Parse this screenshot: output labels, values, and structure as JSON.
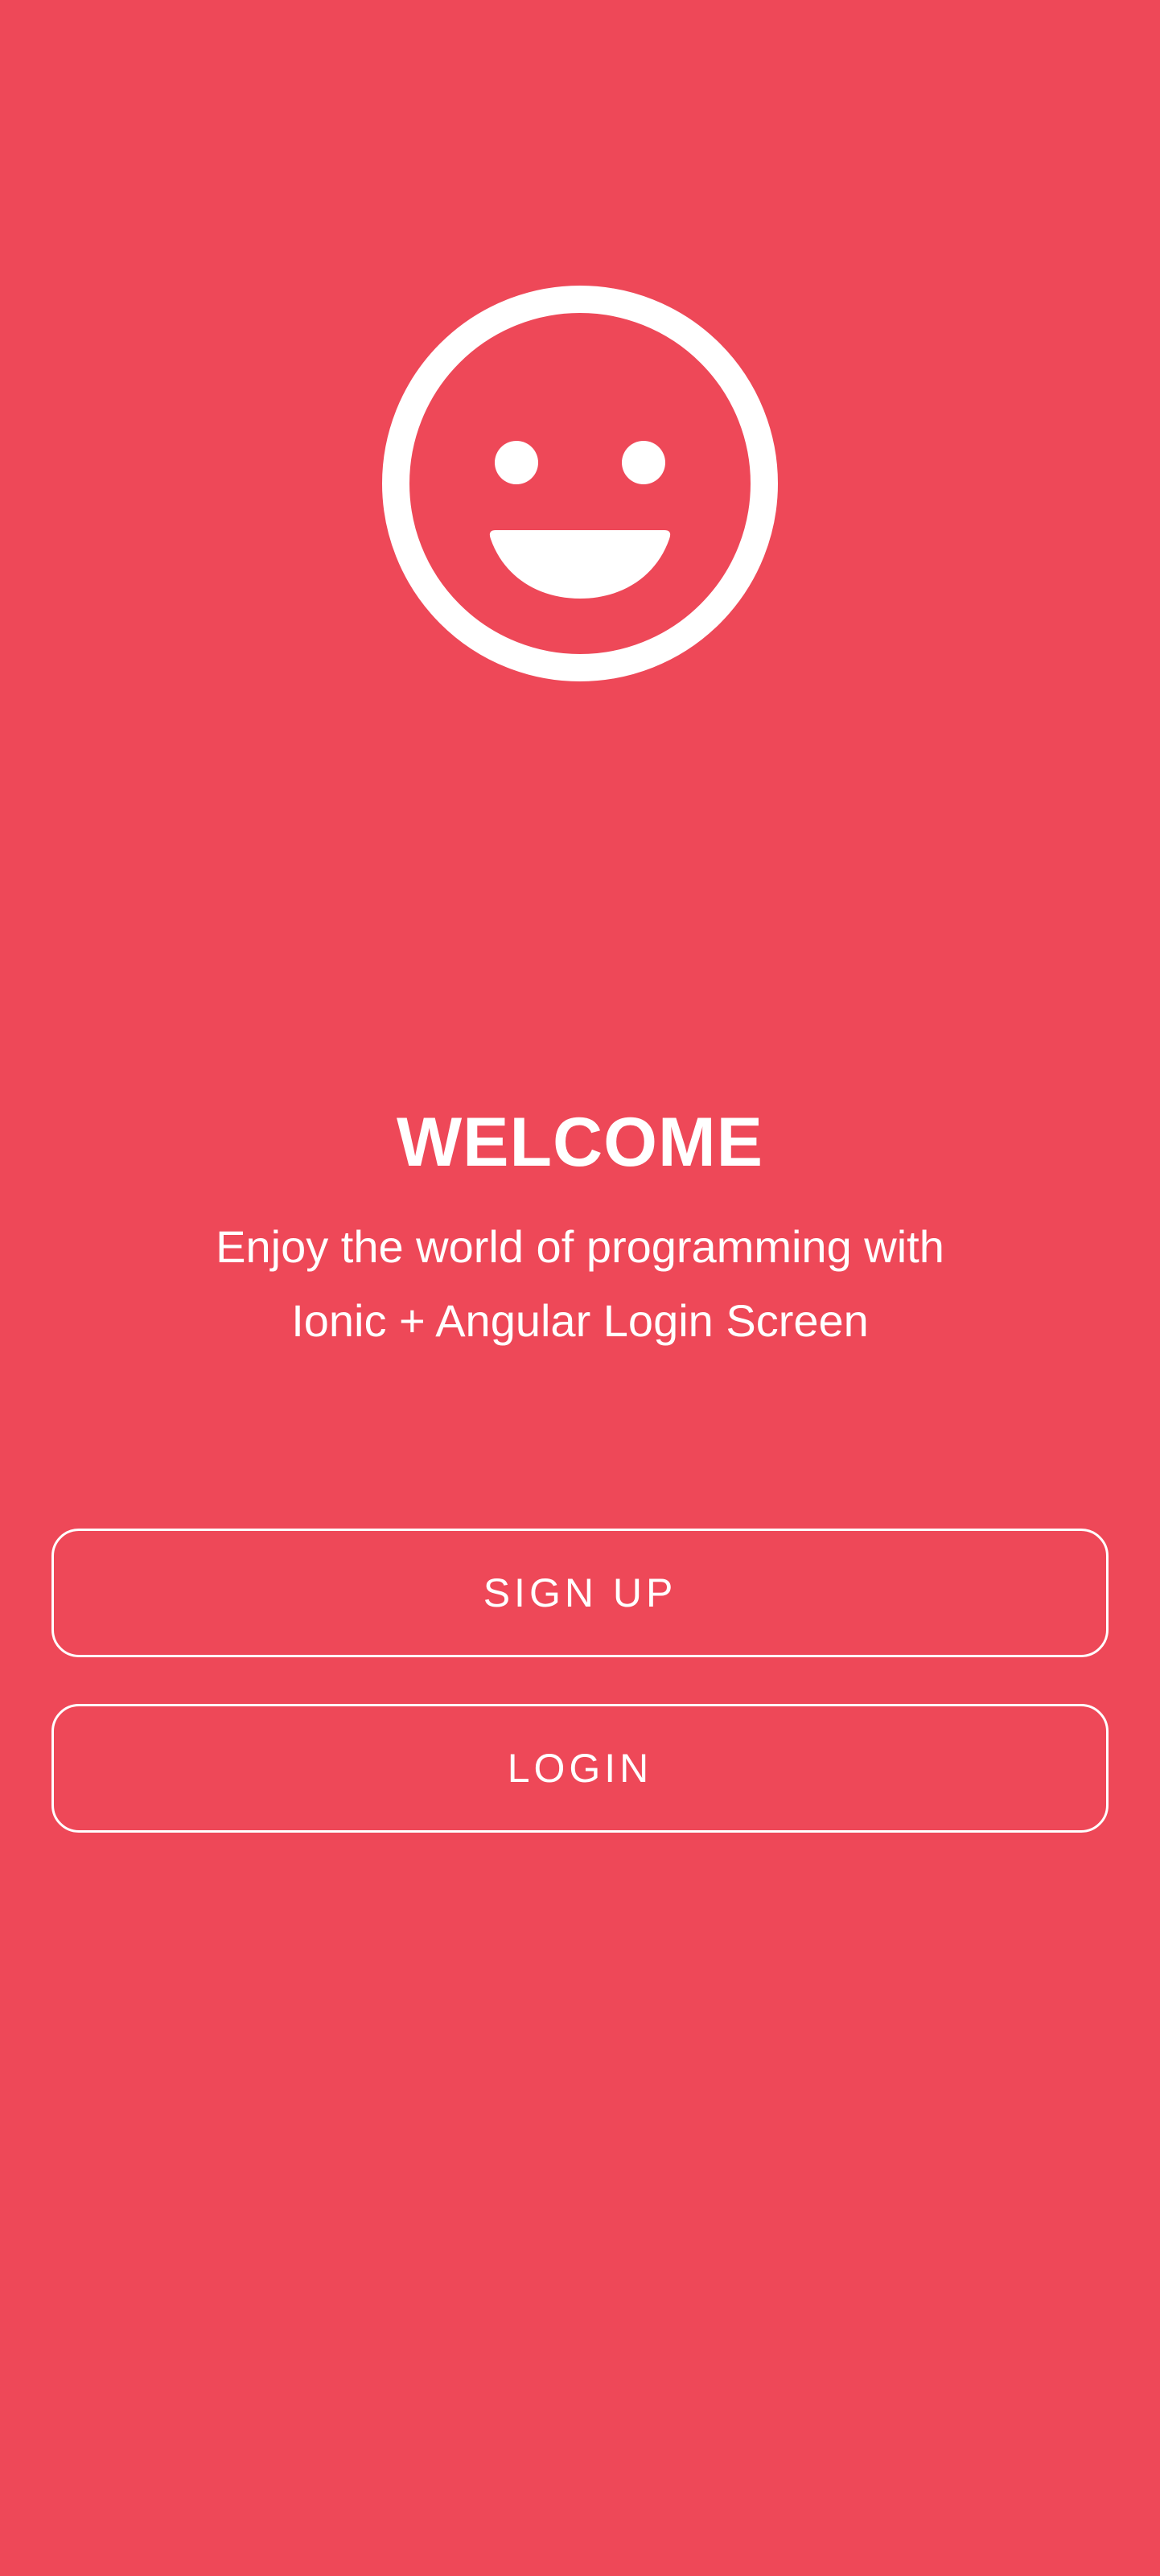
{
  "theme": {
    "background": "#ee4858",
    "foreground": "#ffffff"
  },
  "hero": {
    "icon": "happy-outline-icon"
  },
  "welcome": {
    "title": "WELCOME",
    "subtitle_line1": "Enjoy the world of programming with",
    "subtitle_line2": "Ionic + Angular Login Screen"
  },
  "actions": {
    "signup_label": "SIGN UP",
    "login_label": "LOGIN"
  }
}
